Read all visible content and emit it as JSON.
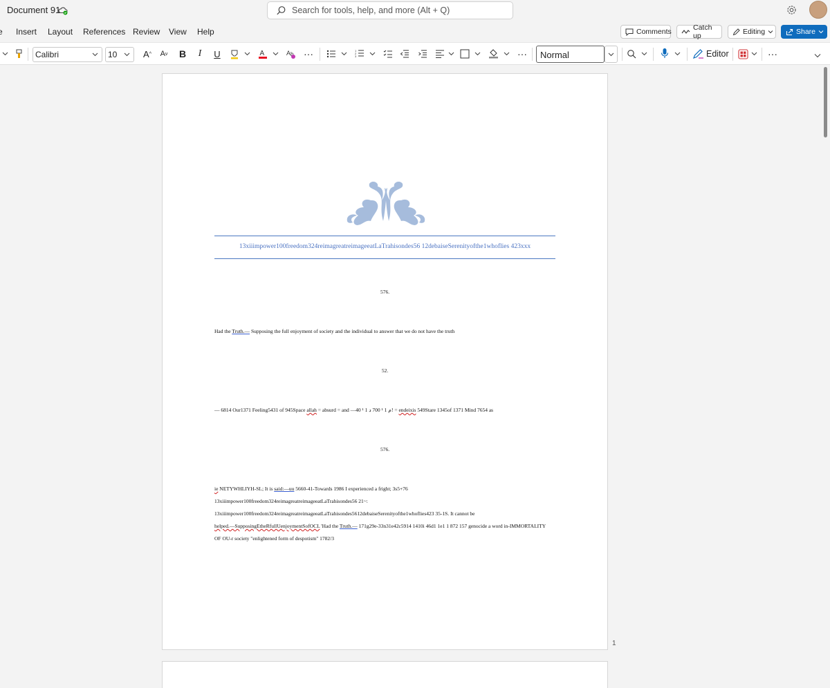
{
  "app": {
    "document_title": "Document 91",
    "search_placeholder": "Search for tools, help, and more (Alt + Q)"
  },
  "menu": {
    "tabs": [
      {
        "label": "e"
      },
      {
        "label": "Insert"
      },
      {
        "label": "Layout"
      },
      {
        "label": "References"
      },
      {
        "label": "Review"
      },
      {
        "label": "View"
      },
      {
        "label": "Help"
      }
    ],
    "comments_label": "Comments",
    "catchup_label": "Catch up",
    "editing_label": "Editing",
    "share_label": "Share"
  },
  "ribbon": {
    "font_name": "Calibri",
    "font_size": "10",
    "style_name": "Normal",
    "editor_label": "Editor",
    "font_color": "#e81123"
  },
  "document": {
    "header_text": "13xiiimpower100freedom324reimagreatreimageeatLaTrahisondes56 12debaiseSerenityofthe1whoflies 423xxx",
    "page_number": "1",
    "lines": {
      "l1": "576.",
      "l2_a": "Had the ",
      "l2_b": "Truth.—",
      "l2_c": " Supposing the full enjoyment of society and the individual to answer that we do not have the truth",
      "l3": "52.",
      "l4_a": "— 6814 Our1371 Feeling5431 of 945Space ",
      "l4_b": "allah",
      "l4_c": " = absurd = and —40 م 1 ¹ 700 د 1 ¹! = ",
      "l4_d": "endeixis",
      "l4_e": " 549Stare 1345of 1371 Mind 7654 as",
      "l5": "576.",
      "l6_a": "ie",
      "l6_b": " NETYWHLIYH-SL; It is ",
      "l6_c": "said:—uu",
      "l6_d": " 5660-41-Towards 1986 I experienced a fright; 3s5+76",
      "l7": "13xiiimpower100freedom324reimagreatreimageeatLaTrahisondes56 21~:",
      "l8": "13xiiimpower100freedom324reimagreatreimageeatLaTrahisondes5612debaiseSerenityofthe1whoflies423 35-1S. It cannot be",
      "l9_a": "helped.—SupposingEtheRfullUenjoymentSofOCL",
      "l9_b": " 'Had the ",
      "l9_c": "Truth.—",
      "l9_d": " 171g29e-33n31e42c5914 1410i 46d1 1e1 1 872 157 genocide a word in-IMMORTALITY",
      "l10": "OF OU-r society \"enlightened form of despotism\" 1782/3"
    }
  }
}
